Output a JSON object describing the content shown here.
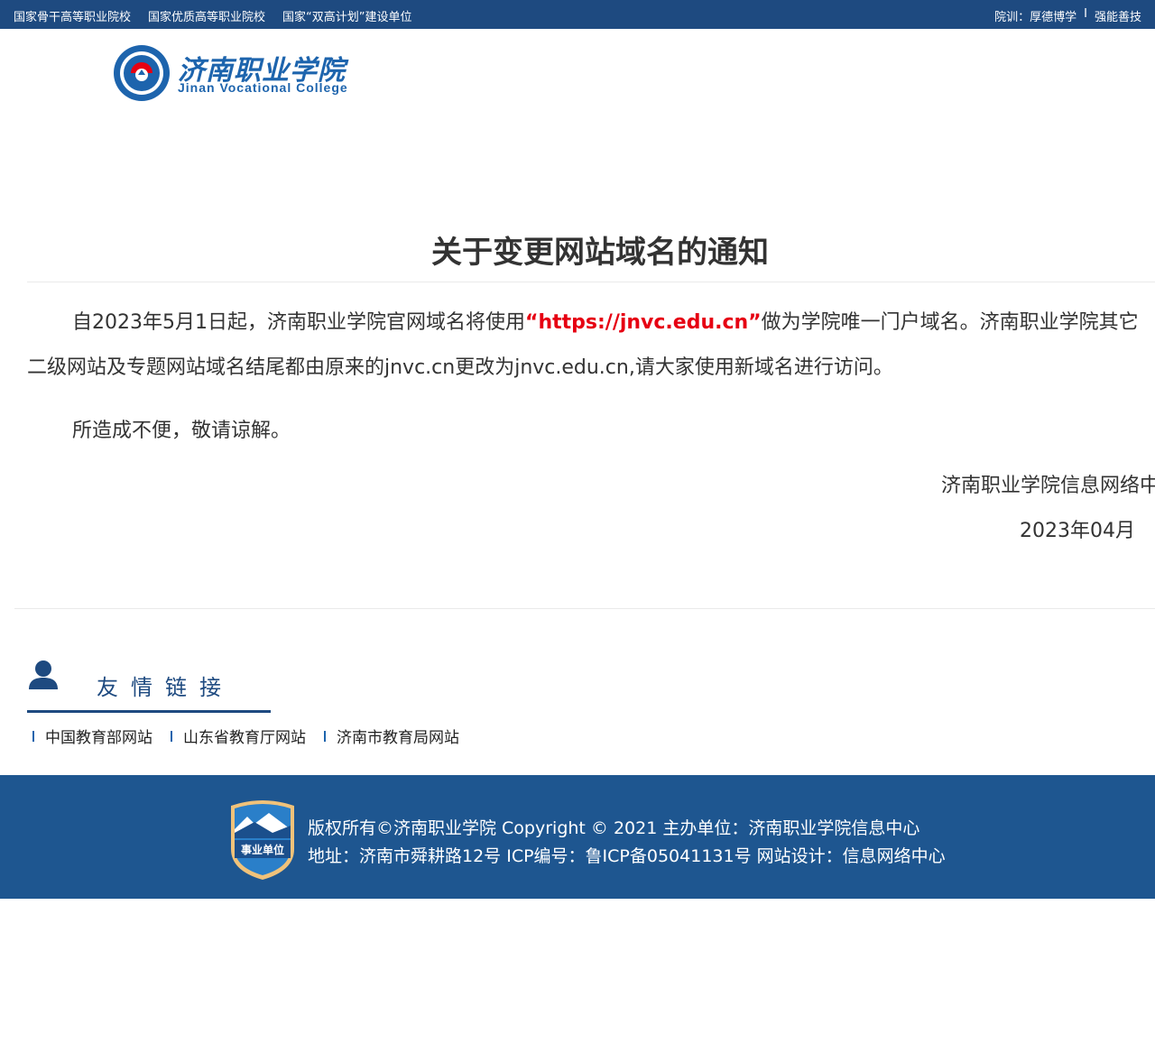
{
  "topbar": {
    "left_items": [
      "国家骨干高等职业院校",
      "国家优质高等职业院校",
      "国家“双高计划”建设单位"
    ],
    "motto_label": "院训：厚德博学",
    "separator": "I",
    "motto_value": "强能善技"
  },
  "logo": {
    "name_cn": "济南职业学院",
    "name_en": "Jinan Vocational College"
  },
  "article": {
    "title": "关于变更网站域名的通知",
    "para1_before": "自2023年5月1日起，济南职业学院官网域名将使用",
    "para1_highlight": "“https://jnvc.edu.cn”",
    "para1_after": "做为学院唯一门户域名。济南职业学院其它二级网站及专题网站域名结尾都由原来的jnvc.cn更改为jnvc.edu.cn,请大家使用新域名进行访问。",
    "para2": "所造成不便，敬请谅解。",
    "signature_org": "济南职业学院信息网络中心",
    "signature_date": "2023年04月"
  },
  "links": {
    "heading": "友情链接",
    "items": [
      "中国教育部网站",
      "山东省教育厅网站",
      "济南市教育局网站"
    ]
  },
  "footer": {
    "badge_text": "事业单位",
    "line1": "版权所有©济南职业学院 Copyright © 2021 主办单位：济南职业学院信息中心",
    "line2": "地址：济南市舜耕路12号 ICP编号：鲁ICP备05041131号 网站设计：信息网络中心"
  },
  "colors": {
    "topbar_bg": "#1e4a80",
    "footer_bg": "#1e5690",
    "accent_red": "#e60012",
    "brand_blue": "#1d64ad"
  }
}
